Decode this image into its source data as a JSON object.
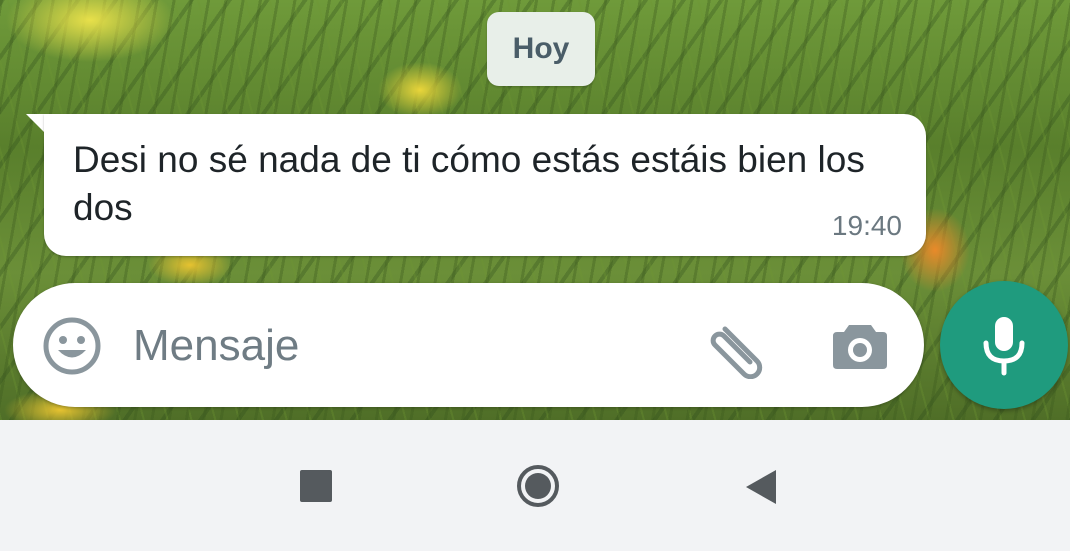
{
  "chat": {
    "date_separator": "Hoy",
    "message": {
      "text": "Desi no sé nada de ti cómo estás estáis bien los dos",
      "time": "19:40"
    }
  },
  "composer": {
    "placeholder": "Mensaje",
    "value": "",
    "emoji_icon": "emoji-icon",
    "attach_icon": "paperclip-icon",
    "camera_icon": "camera-icon",
    "mic_icon": "microphone-icon"
  },
  "navigation": {
    "recents_icon": "square-icon",
    "home_icon": "circle-icon",
    "back_icon": "triangle-back-icon"
  },
  "colors": {
    "accent": "#1f9b7e",
    "bubble": "#ffffff",
    "date_chip": "#e8efe9",
    "icon_gray": "#8a969d"
  }
}
